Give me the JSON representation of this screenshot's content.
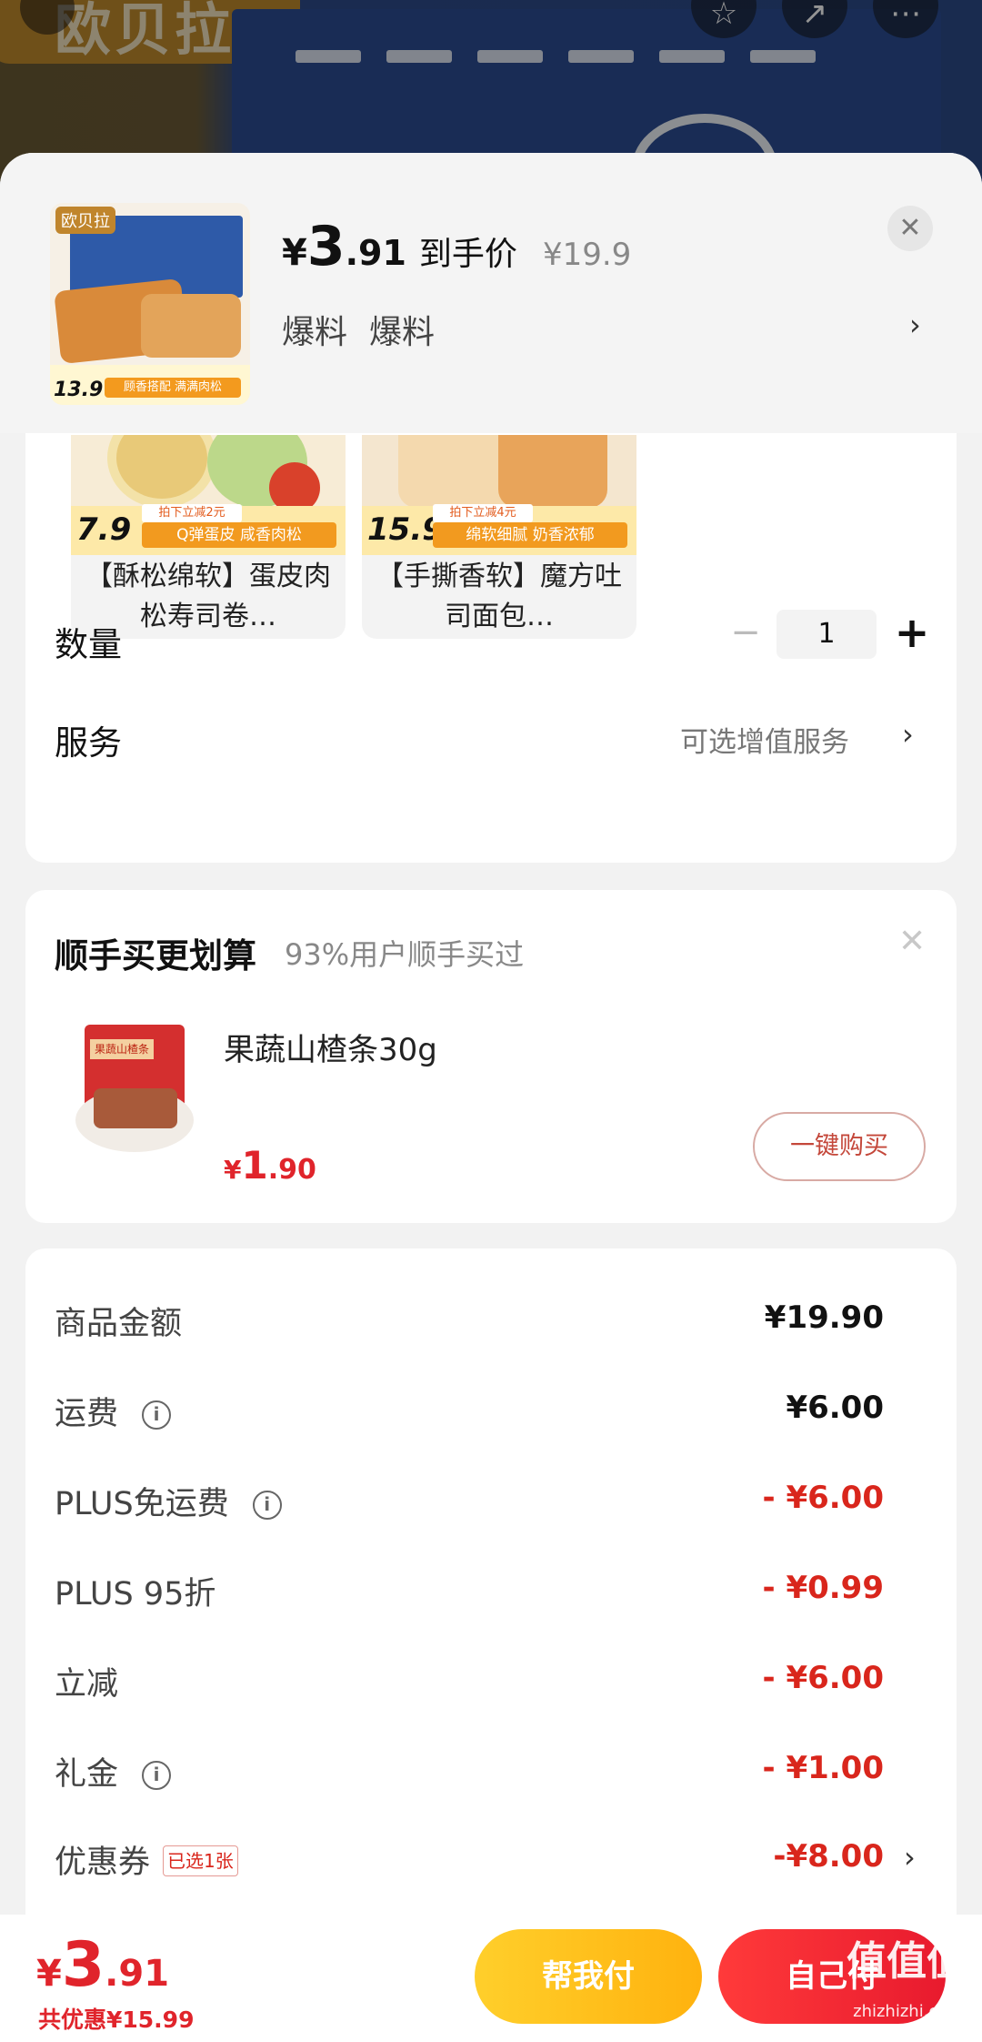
{
  "background": {
    "brand_text": "欧贝拉",
    "top_icons": [
      "star-icon",
      "share-icon",
      "more-icon"
    ]
  },
  "header": {
    "price_symbol": "¥",
    "price_int": "3",
    "price_dec": ".91",
    "price_tag": "到手价",
    "original_price": "¥19.9",
    "specs": [
      "爆料",
      "爆料"
    ],
    "thumb_brand": "欧贝拉",
    "thumb_price": "13.9",
    "thumb_promo": "顾香搭配 满满肉松"
  },
  "variants": [
    {
      "price": "7.9",
      "promo_top": "拍下立减2元",
      "promo": "Q弹蛋皮 咸香肉松",
      "title": "【酥松绵软】蛋皮肉松寿司卷…"
    },
    {
      "price": "15.9",
      "promo_top": "拍下立减4元",
      "promo": "绵软细腻 奶香浓郁",
      "title": "【手撕香软】魔方吐司面包…"
    }
  ],
  "quantity": {
    "label": "数量",
    "minus": "−",
    "value": "1",
    "plus": "+"
  },
  "service": {
    "label": "服务",
    "value": "可选增值服务"
  },
  "addon": {
    "title": "顺手买更划算",
    "subtitle": "93%用户顺手买过",
    "product_name": "果蔬山楂条30g",
    "bag_label": "果蔬山楂条",
    "price_symbol": "¥",
    "price_int": "1",
    "price_dec": ".90",
    "buy_button": "一键购买"
  },
  "summary": {
    "rows": [
      {
        "label": "商品金额",
        "value": "¥19.90",
        "info": false,
        "red": false
      },
      {
        "label": "运费",
        "value": "¥6.00",
        "info": true,
        "red": false
      },
      {
        "label": "PLUS免运费",
        "value": "- ¥6.00",
        "info": true,
        "red": true
      },
      {
        "label": "PLUS 95折",
        "value": "- ¥0.99",
        "info": false,
        "red": true
      },
      {
        "label": "立减",
        "value": "- ¥6.00",
        "info": false,
        "red": true
      },
      {
        "label": "礼金",
        "value": "- ¥1.00",
        "info": true,
        "red": true
      }
    ],
    "coupon": {
      "label": "优惠券",
      "chip": "已选1张",
      "value": "-¥8.00"
    }
  },
  "bottom": {
    "price_symbol": "¥",
    "price_int": "3",
    "price_dec": ".91",
    "saving": "共优惠¥15.99",
    "help_pay": "帮我付",
    "self_pay": "自己付"
  },
  "watermark": {
    "text": "值值值",
    "site": "zhizhizhi.com"
  },
  "colors": {
    "accent_red": "#e0242b",
    "help_yellow": "#ffbd18",
    "self_red": "#f0262e"
  }
}
